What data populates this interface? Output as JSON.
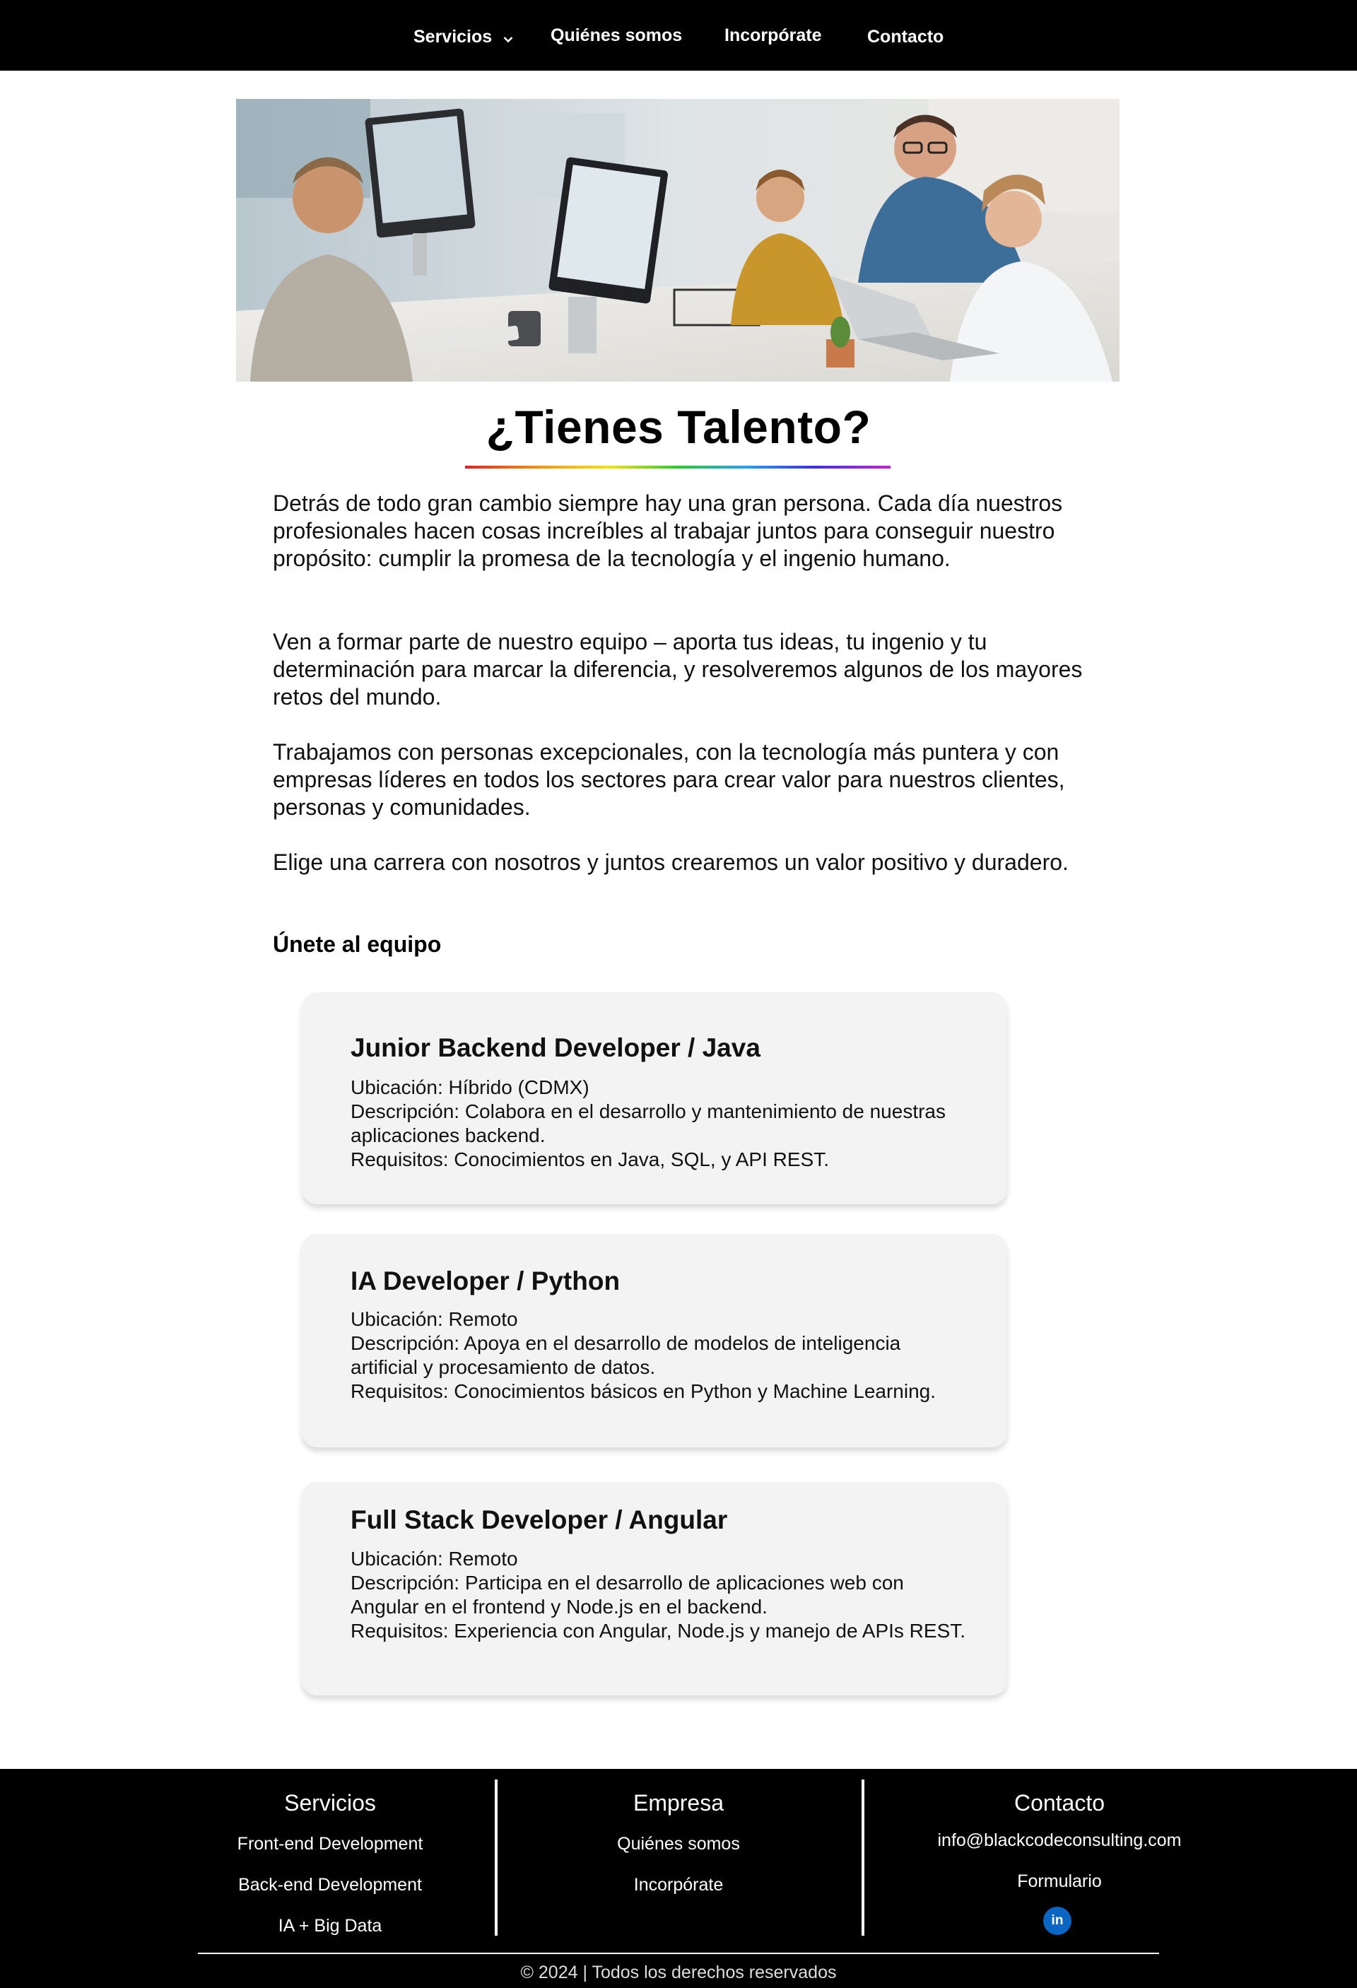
{
  "nav": {
    "items": [
      {
        "label": "Servicios"
      },
      {
        "label": "Quiénes somos"
      },
      {
        "label": "Incorpórate"
      },
      {
        "label": "Contacto"
      }
    ]
  },
  "main": {
    "title": "¿Tienes Talento?",
    "paragraphs": [
      "Detrás de todo gran cambio siempre hay una gran persona. Cada día nuestros profesionales hacen cosas increíbles al trabajar juntos para conseguir nuestro propósito: cumplir la promesa de la tecnología y el ingenio humano.",
      "Ven a formar parte de nuestro equipo – aporta tus ideas, tu ingenio y tu determinación para marcar la diferencia, y resolveremos algunos de los mayores retos del mundo.",
      "Trabajamos con personas excepcionales, con la tecnología más puntera y con empresas líderes en todos los sectores para crear valor para nuestros clientes, personas y comunidades.",
      "Elige una carrera con nosotros y juntos crearemos un valor positivo y duradero."
    ],
    "join_heading": "Únete al equipo"
  },
  "jobs": [
    {
      "title": "Junior Backend Developer / Java",
      "location": "Ubicación: Híbrido (CDMX)",
      "description": "Descripción: Colabora en el desarrollo y mantenimiento de nuestras aplicaciones backend.",
      "requirements": "Requisitos: Conocimientos en Java, SQL, y API REST."
    },
    {
      "title": "IA Developer / Python",
      "location": "Ubicación: Remoto",
      "description": "Descripción: Apoya en el desarrollo de modelos de inteligencia artificial y procesamiento de datos.",
      "requirements": "Requisitos: Conocimientos básicos en Python y Machine Learning."
    },
    {
      "title": "Full Stack Developer / Angular",
      "location": "Ubicación: Remoto",
      "description": "Descripción: Participa en el desarrollo de aplicaciones web con Angular en el frontend y Node.js en el backend.",
      "requirements": "Requisitos: Experiencia con Angular, Node.js y manejo de APIs REST."
    }
  ],
  "footer": {
    "servicios": {
      "heading": "Servicios",
      "links": [
        "Front-end Development",
        "Back-end Development",
        "IA + Big Data"
      ]
    },
    "empresa": {
      "heading": "Empresa",
      "links": [
        "Quiénes somos",
        "Incorpórate"
      ]
    },
    "contacto": {
      "heading": "Contacto",
      "email": "info@blackcodeconsulting.com",
      "form": "Formulario",
      "linkedin_icon_text": "in"
    },
    "copyright": "© 2024 | Todos los derechos reservados"
  },
  "icons": {
    "servicios_dropdown": "chevron-down-icon",
    "social": "linkedin-icon"
  },
  "colors": {
    "nav_bg": "#000000",
    "footer_bg": "#000000",
    "card_bg": "#f3f3f3",
    "linkedin": "#0a66c2"
  }
}
